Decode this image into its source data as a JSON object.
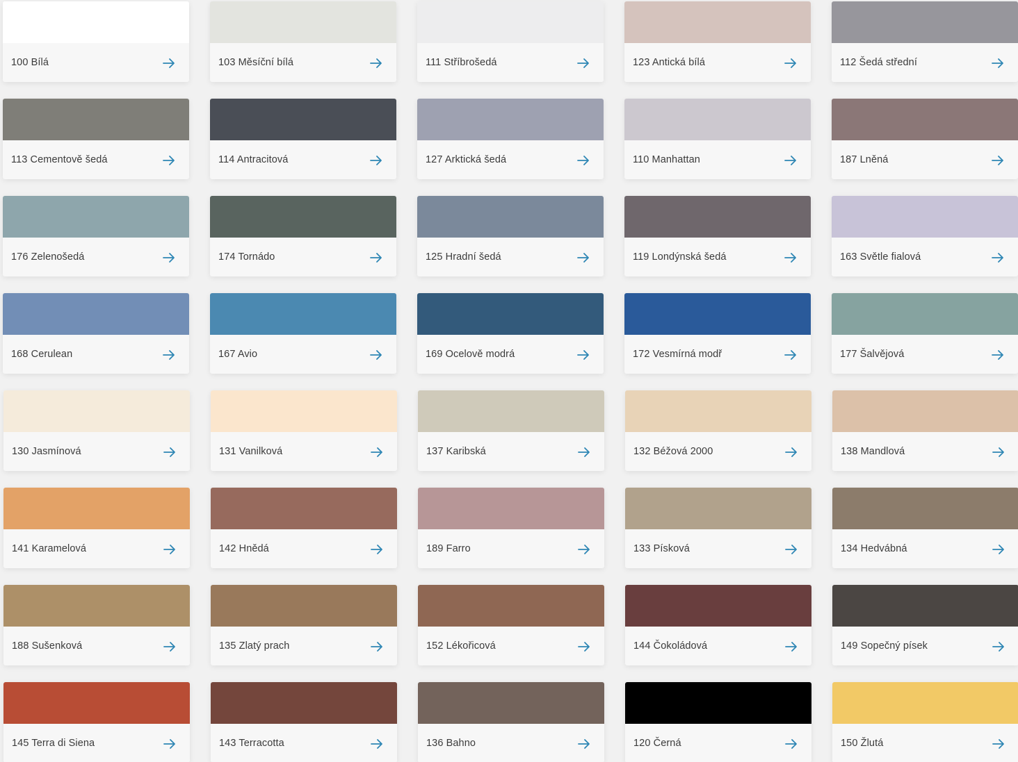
{
  "sections": [
    {
      "name": "grays-blues",
      "colors": [
        {
          "label": "100 Bílá",
          "hex": "#ffffff"
        },
        {
          "label": "103 Měsíční bílá",
          "hex": "#e3e4df"
        },
        {
          "label": "111 Stříbrošedá",
          "hex": "#ededee"
        },
        {
          "label": "123 Antická bílá",
          "hex": "#d5c3bd"
        },
        {
          "label": "112 Šedá střední",
          "hex": "#97969c"
        },
        {
          "label": "113 Cementově šedá",
          "hex": "#7f7e78"
        },
        {
          "label": "114 Antracitová",
          "hex": "#4a4e56"
        },
        {
          "label": "127 Arktická šedá",
          "hex": "#9ea1b1"
        },
        {
          "label": "110 Manhattan",
          "hex": "#ccc8cf"
        },
        {
          "label": "187 Lněná",
          "hex": "#8b7777"
        },
        {
          "label": "176 Zelenošedá",
          "hex": "#8ea6ac"
        },
        {
          "label": "174 Tornádo",
          "hex": "#59645f"
        },
        {
          "label": "125 Hradní šedá",
          "hex": "#7b899b"
        },
        {
          "label": "119 Londýnská šedá",
          "hex": "#6f676c"
        },
        {
          "label": "163 Světle fialová",
          "hex": "#c8c3d8"
        },
        {
          "label": "168 Cerulean",
          "hex": "#728eb6"
        },
        {
          "label": "167 Avio",
          "hex": "#4b89b1"
        },
        {
          "label": "169 Ocelově modrá",
          "hex": "#335a7b"
        },
        {
          "label": "172 Vesmírná modř",
          "hex": "#2a5a9a"
        },
        {
          "label": "177 Šalvějová",
          "hex": "#86a3a0"
        }
      ]
    },
    {
      "name": "warm-tones",
      "colors": [
        {
          "label": "130 Jasmínová",
          "hex": "#f5ebdb"
        },
        {
          "label": "131 Vanilková",
          "hex": "#fbe6cd"
        },
        {
          "label": "137 Karibská",
          "hex": "#cfcaba"
        },
        {
          "label": "132 Béžová 2000",
          "hex": "#e8d3b7"
        },
        {
          "label": "138 Mandlová",
          "hex": "#dcc1a9"
        },
        {
          "label": "141 Karamelová",
          "hex": "#e3a267"
        },
        {
          "label": "142 Hnědá",
          "hex": "#976a5d"
        },
        {
          "label": "189 Farro",
          "hex": "#b79697"
        },
        {
          "label": "133 Písková",
          "hex": "#b1a28c"
        },
        {
          "label": "134 Hedvábná",
          "hex": "#8c7c6b"
        },
        {
          "label": "188 Sušenková",
          "hex": "#ad9068"
        },
        {
          "label": "135 Zlatý prach",
          "hex": "#99795b"
        },
        {
          "label": "152 Lékořicová",
          "hex": "#8f6753"
        },
        {
          "label": "144 Čokoládová",
          "hex": "#693e3e"
        },
        {
          "label": "149 Sopečný písek",
          "hex": "#4b4643"
        },
        {
          "label": "145 Terra di Siena",
          "hex": "#b84d35"
        },
        {
          "label": "143 Terracotta",
          "hex": "#74463c"
        },
        {
          "label": "136 Bahno",
          "hex": "#73635b"
        },
        {
          "label": "120 Černá",
          "hex": "#000000"
        },
        {
          "label": "150 Žlutá",
          "hex": "#f2c966"
        }
      ]
    }
  ],
  "arrow_color": "#2e86b4",
  "arrow_icon": "arrow-right-icon"
}
